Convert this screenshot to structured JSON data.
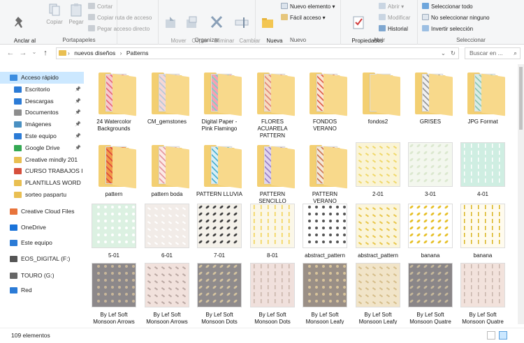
{
  "ribbon": {
    "clipboard": {
      "label": "Portapapeles",
      "pin": "Anclar al\nAcceso rápido",
      "copy": "Copiar",
      "paste": "Pegar",
      "cut": "Cortar",
      "copy_path": "Copiar ruta de acceso",
      "paste_shortcut": "Pegar acceso directo"
    },
    "organize": {
      "label": "Organizar",
      "move": "Mover\na ▾",
      "copy": "Copiar\na ▾",
      "delete": "Eliminar\n▾",
      "rename": "Cambiar\nnombre"
    },
    "new": {
      "label": "Nuevo",
      "new_folder": "Nueva\ncarpeta",
      "new_item": "Nuevo elemento ▾",
      "easy_access": "Fácil acceso ▾"
    },
    "open": {
      "label": "Abrir",
      "properties": "Propiedades\n▾",
      "open": "Abrir ▾",
      "edit": "Modificar",
      "history": "Historial"
    },
    "select": {
      "label": "Seleccionar",
      "all": "Seleccionar todo",
      "none": "No seleccionar ninguno",
      "invert": "Invertir selección"
    }
  },
  "address": {
    "path": [
      "nuevos diseños",
      "Patterns"
    ],
    "separator": "›",
    "search_placeholder": "Buscar en ..."
  },
  "nav": [
    {
      "label": "Acceso rápido",
      "icon": "star-icon",
      "color": "#3c8de0",
      "pinned": false,
      "selected": true
    },
    {
      "label": "Escritorio",
      "icon": "desktop-icon",
      "color": "#2b7bd6",
      "pinned": true
    },
    {
      "label": "Descargas",
      "icon": "download-icon",
      "color": "#2b7bd6",
      "pinned": true
    },
    {
      "label": "Documentos",
      "icon": "documents-icon",
      "color": "#8d8d8d",
      "pinned": true
    },
    {
      "label": "Imágenes",
      "icon": "pictures-icon",
      "color": "#4a90c2",
      "pinned": true
    },
    {
      "label": "Este equipo",
      "icon": "computer-icon",
      "color": "#2b7bd6",
      "pinned": true
    },
    {
      "label": "Google Drive",
      "icon": "drive-icon",
      "color": "#34a853",
      "pinned": true
    },
    {
      "label": "Creative mindly 201",
      "icon": "folder-icon",
      "color": "#e9bf52",
      "pinned": false
    },
    {
      "label": "CURSO TRABAJOS I",
      "icon": "folder-icon",
      "color": "#d64f3c",
      "pinned": false
    },
    {
      "label": "PLANTILLAS WORD",
      "icon": "folder-icon",
      "color": "#e9bf52",
      "pinned": false
    },
    {
      "label": "sorteo paspartu",
      "icon": "folder-icon",
      "color": "#e9bf52",
      "pinned": false
    },
    {
      "label": "Creative Cloud Files",
      "icon": "creative-cloud-icon",
      "color": "#e8743b",
      "pinned": false
    },
    {
      "label": "OneDrive",
      "icon": "onedrive-icon",
      "color": "#1a73d9",
      "pinned": false
    },
    {
      "label": "Este equipo",
      "icon": "computer-icon",
      "color": "#2b7bd6",
      "pinned": false
    },
    {
      "label": "EOS_DIGITAL (F:)",
      "icon": "sd-card-icon",
      "color": "#555555",
      "pinned": false
    },
    {
      "label": "TOURO (G:)",
      "icon": "drive-disk-icon",
      "color": "#666666",
      "pinned": false
    },
    {
      "label": "Red",
      "icon": "network-icon",
      "color": "#2b7bd6",
      "pinned": false
    }
  ],
  "items": [
    {
      "name": "24 Watercolor\nBackgrounds",
      "kind": "folder",
      "paper": [
        "#f6c9cf",
        "#e86b7b"
      ]
    },
    {
      "name": "CM_gemstones",
      "kind": "folder",
      "paper": [
        "#f4d7d7",
        "#b9c9d9"
      ]
    },
    {
      "name": "Digital Paper -\nPink Flamingo",
      "kind": "folder",
      "paper": [
        "#f5a2b2",
        "#7fd0c6"
      ]
    },
    {
      "name": "FLORES\nACUARELA\nPATTERN",
      "kind": "folder",
      "paper": [
        "#f7dcc0",
        "#e2897a"
      ]
    },
    {
      "name": "FONDOS\nVERANO",
      "kind": "folder",
      "paper": [
        "#fbe3d4",
        "#e0634c"
      ]
    },
    {
      "name": "fondos2",
      "kind": "folder",
      "paper": [
        "#f8d98b",
        "#f8d98b"
      ]
    },
    {
      "name": "GRISES",
      "kind": "folder",
      "paper": [
        "#f0f0f0",
        "#9a9a9a"
      ]
    },
    {
      "name": "JPG Format",
      "kind": "folder",
      "paper": [
        "#d8ece6",
        "#8fc6b4"
      ]
    },
    {
      "name": "pattern",
      "kind": "folder",
      "paper": [
        "#f29a4a",
        "#e04c3a"
      ]
    },
    {
      "name": "pattern boda",
      "kind": "folder",
      "paper": [
        "#fbe9e6",
        "#e79aa0"
      ]
    },
    {
      "name": "PATTERN LLUVIA",
      "kind": "folder",
      "paper": [
        "#d7eef5",
        "#4fb2d0"
      ]
    },
    {
      "name": "PATTERN\nSENCILLO",
      "kind": "folder",
      "paper": [
        "#e0d4ef",
        "#9c86c7"
      ]
    },
    {
      "name": "PATTERN\nVERANO",
      "kind": "folder",
      "paper": [
        "#f3e7d9",
        "#d07a55"
      ]
    },
    {
      "name": "2-01",
      "kind": "image",
      "bg": "#faf4d6",
      "fg": "#f0d86a"
    },
    {
      "name": "3-01",
      "kind": "image",
      "bg": "#f3f7ee",
      "fg": "#dbe8cf"
    },
    {
      "name": "4-01",
      "kind": "image",
      "bg": "#cfeee2",
      "fg": "#ffffff"
    },
    {
      "name": "5-01",
      "kind": "image",
      "bg": "#dcf1e2",
      "fg": "#ffffff"
    },
    {
      "name": "6-01",
      "kind": "image",
      "bg": "#f2ece8",
      "fg": "#ffffff"
    },
    {
      "name": "7-01",
      "kind": "image",
      "bg": "#f4f1ea",
      "fg": "#404040"
    },
    {
      "name": "8-01",
      "kind": "image",
      "bg": "#fbf7e8",
      "fg": "#f2d04b"
    },
    {
      "name": "abstract_pattern",
      "kind": "image",
      "bg": "#ffffff",
      "fg": "#555555"
    },
    {
      "name": "abstract_pattern",
      "kind": "image",
      "bg": "#fbf5da",
      "fg": "#e8c64a"
    },
    {
      "name": "banana",
      "kind": "image",
      "bg": "#ffffff",
      "fg": "#e6c02a"
    },
    {
      "name": "banana",
      "kind": "image",
      "bg": "#fffbee",
      "fg": "#d9b420"
    },
    {
      "name": "By Lef Soft\nMonsoon Arrows\nMonsoon Gray",
      "kind": "image",
      "bg": "#8c888a",
      "fg": "#c9b79a"
    },
    {
      "name": "By Lef Soft\nMonsoon Arrows\nPink",
      "kind": "image",
      "bg": "#f1e1dc",
      "fg": "#b9a7a2"
    },
    {
      "name": "By Lef Soft\nMonsoon Dots\nMonsoon Gray",
      "kind": "image",
      "bg": "#8f8b8c",
      "fg": "#d4c39f"
    },
    {
      "name": "By Lef Soft\nMonsoon Dots\nPink",
      "kind": "image",
      "bg": "#f0e0dc",
      "fg": "#c7b3a8"
    },
    {
      "name": "By Lef Soft\nMonsoon Leafy\nMonsoon Gray",
      "kind": "image",
      "bg": "#9a8f86",
      "fg": "#d8c49b"
    },
    {
      "name": "By Lef Soft\nMonsoon Leafy\nPink",
      "kind": "image",
      "bg": "#f1e4c8",
      "fg": "#d5bd8a"
    },
    {
      "name": "By Lef Soft\nMonsoon Quatre\nMonsoon Gray",
      "kind": "image",
      "bg": "#8a8688",
      "fg": "#c6b89b"
    },
    {
      "name": "By Lef Soft\nMonsoon Quatre\nPink",
      "kind": "image",
      "bg": "#f2e2dc",
      "fg": "#c8b5ad"
    }
  ],
  "status": {
    "count": "109 elementos"
  }
}
